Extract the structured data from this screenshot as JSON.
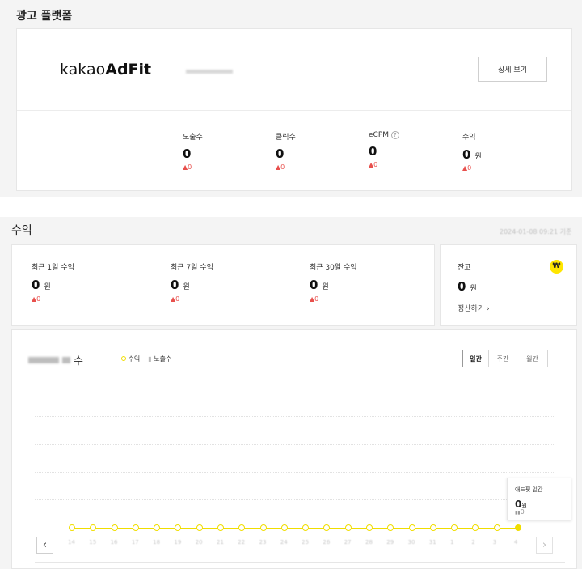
{
  "platform": {
    "title": "광고 플랫폼",
    "logo_light": "kakao",
    "logo_bold": "AdFit",
    "detail_button": "상세 보기",
    "stats": [
      {
        "label": "노출수",
        "value": "0",
        "unit": "",
        "change": "▲0"
      },
      {
        "label": "클릭수",
        "value": "0",
        "unit": "",
        "change": "▲0"
      },
      {
        "label": "eCPM",
        "value": "0",
        "unit": "",
        "change": "▲0",
        "help": "?"
      },
      {
        "label": "수익",
        "value": "0",
        "unit": "원",
        "change": "▲0"
      }
    ]
  },
  "revenue": {
    "title": "수익",
    "timestamp": "2024-01-08 09:21 기준",
    "periods": [
      {
        "label": "최근 1일 수익",
        "value": "0",
        "unit": "원",
        "change": "▲0"
      },
      {
        "label": "최근 7일 수익",
        "value": "0",
        "unit": "원",
        "change": "▲0"
      },
      {
        "label": "최근 30일 수익",
        "value": "0",
        "unit": "원",
        "change": "▲0"
      }
    ],
    "balance": {
      "label": "잔고",
      "value": "0",
      "unit": "원",
      "settle_link": "정산하기 ›",
      "badge": "₩"
    }
  },
  "chart": {
    "title_suffix": "수",
    "legend_revenue": "수익",
    "legend_impressions": "노출수",
    "tabs": [
      "일간",
      "주간",
      "월간"
    ],
    "active_tab": "일간",
    "prev_arrow": "‹",
    "next_arrow": "›",
    "tooltip": {
      "title": "애드핏 일간",
      "value": "0",
      "unit": "원",
      "sub": "0"
    },
    "accent": "#f0dd00"
  },
  "chart_data": {
    "type": "line",
    "x": [
      "14",
      "15",
      "16",
      "17",
      "18",
      "19",
      "20",
      "21",
      "22",
      "23",
      "24",
      "25",
      "26",
      "27",
      "28",
      "29",
      "30",
      "31",
      "1",
      "2",
      "3",
      "4"
    ],
    "series": [
      {
        "name": "수익",
        "values": [
          0,
          0,
          0,
          0,
          0,
          0,
          0,
          0,
          0,
          0,
          0,
          0,
          0,
          0,
          0,
          0,
          0,
          0,
          0,
          0,
          0,
          0
        ]
      }
    ]
  }
}
